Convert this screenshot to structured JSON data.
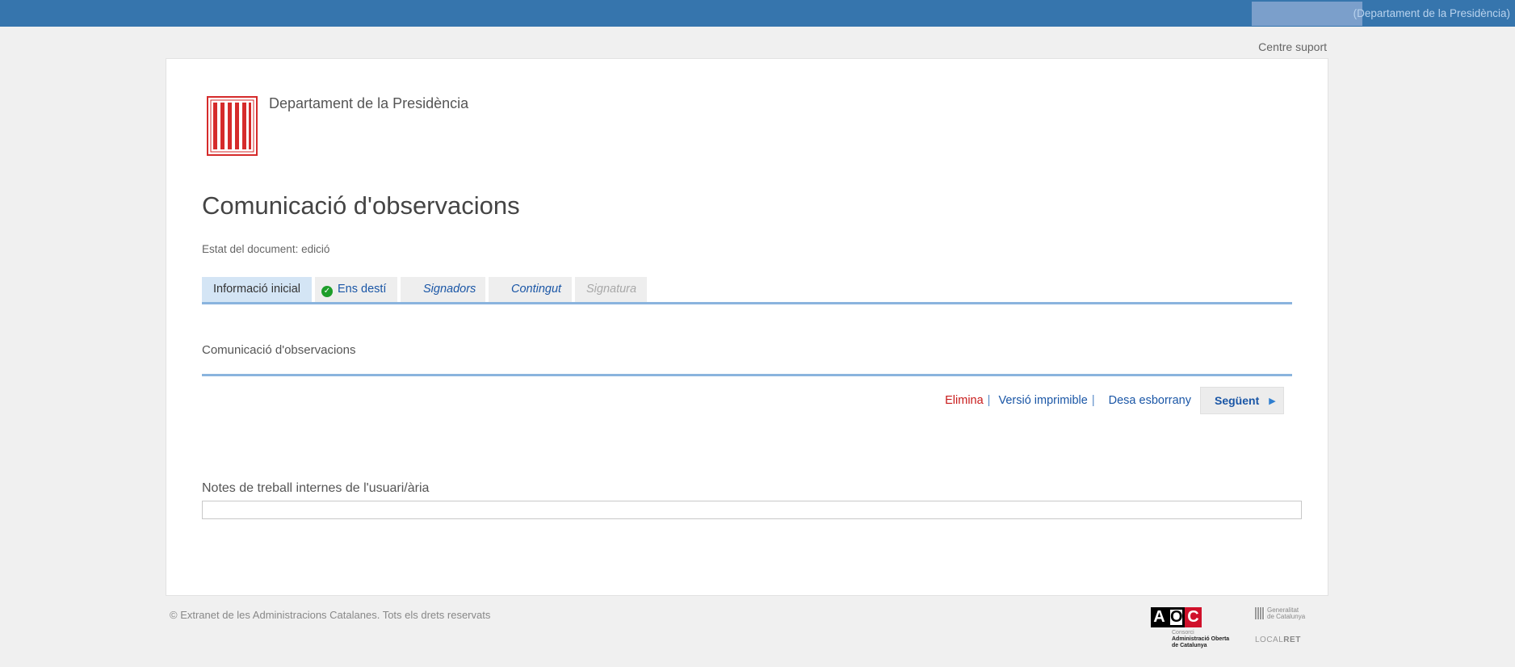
{
  "header": {
    "user_department": "(Departament de la Presidència)"
  },
  "support": {
    "label": "Centre suport"
  },
  "organization": {
    "name": "Departament de la Presidència"
  },
  "document": {
    "title": "Comunicació d'observacions",
    "status": "Estat del document: edició"
  },
  "tabs": [
    {
      "label": "Informació inicial",
      "state": "active"
    },
    {
      "label": "Ens destí",
      "state": "completed"
    },
    {
      "label": "Signadors",
      "state": "link"
    },
    {
      "label": "Contingut",
      "state": "link"
    },
    {
      "label": "Signatura",
      "state": "disabled"
    }
  ],
  "section": {
    "title": "Comunicació d'observacions"
  },
  "actions": {
    "delete": "Elimina",
    "separator": "|",
    "printable": "Versió imprimible",
    "save_draft": "Desa esborrany",
    "next": "Següent"
  },
  "notes": {
    "label": "Notes de treball internes de l'usuari/ària",
    "value": ""
  },
  "footer": {
    "copyright": "© Extranet de les Administracions Catalanes. Tots els drets reservats",
    "aoc_letters": [
      "A",
      "O",
      "C"
    ],
    "aoc_small": "Consorci",
    "aoc_text_1": "Administració Oberta",
    "aoc_text_2": "de Catalunya",
    "gen_line1": "Generalitat",
    "gen_line2": "de Catalunya",
    "localret_a": "LOCAL",
    "localret_b": "RET"
  },
  "colors": {
    "topbar": "#3675ad",
    "tab_active": "#d4e5f5",
    "link": "#1a56a6",
    "delete": "#c81a1a",
    "rule": "#8ab4de",
    "check": "#1e9e2a"
  }
}
